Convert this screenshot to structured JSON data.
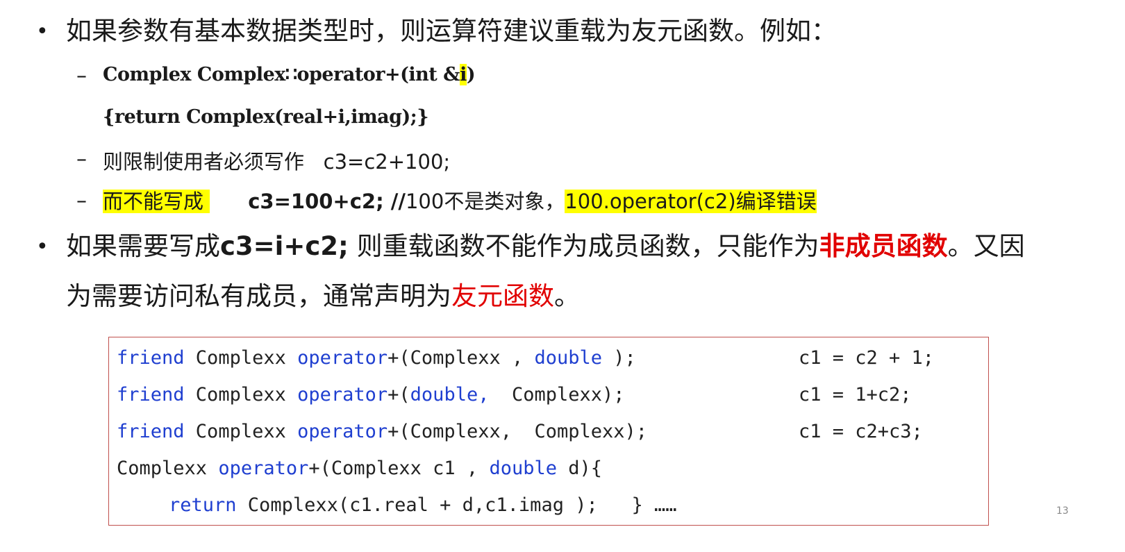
{
  "bullet_symbol": "•",
  "dash_symbol": "–",
  "b1": {
    "text": "如果参数有基本数据类型时，则运算符建议重载为友元函数。例如："
  },
  "code_line1": {
    "pre": "Complex Complex∷operator+(int &",
    "hl": "i",
    "post": ")"
  },
  "code_line2": "{return Complex(real+i,imag);}",
  "sub2": "则限制使用者必须写作   c3=c2+100;",
  "sub3": {
    "hl1": "而不能写成 ",
    "expr": "c3=100+c2; //",
    "mid": "100不是类对象，",
    "hl2": "100.operator(c2)编译错误"
  },
  "b2": {
    "part1": "如果需要写成",
    "expr": "c3=i+c2;",
    "part2": " 则重载函数不能作为成员函数，只能作为",
    "red1": "非成员函数",
    "part3": "。又因",
    "line2": "为需要访问私有成员，通常声明为",
    "red2": "友元函数",
    "end": "。"
  },
  "code_box": {
    "l1": {
      "kw1": "friend",
      "t1": " Complexx ",
      "kw2": "operator",
      "t2": "+(Complexx , ",
      "kw3": "double",
      "t3": " );",
      "usage": "c1 = c2 + 1;"
    },
    "l2": {
      "kw1": "friend",
      "t1": " Complexx ",
      "kw2": "operator",
      "t2": "+(",
      "kw3": "double,",
      "t3": "  Complexx);",
      "usage": "c1 = 1+c2;"
    },
    "l3": {
      "kw1": "friend",
      "t1": " Complexx ",
      "kw2": "operator",
      "t2": "+(Complexx,  Complexx);",
      "usage": "c1 = c2+c3;"
    },
    "l4": {
      "t1": "Complexx ",
      "kw1": "operator",
      "t2": "+(Complexx c1 , ",
      "kw2": "double",
      "t3": " d){"
    },
    "l5": {
      "kw1": "return",
      "t1": " Complexx(c1.real + d,c1.imag );   } ……"
    }
  },
  "page_number": "13",
  "colors": {
    "highlight": "#ffff00",
    "emphasis_red": "#e10000",
    "keyword_blue": "#1f3fd0",
    "box_border": "#c0504d"
  }
}
